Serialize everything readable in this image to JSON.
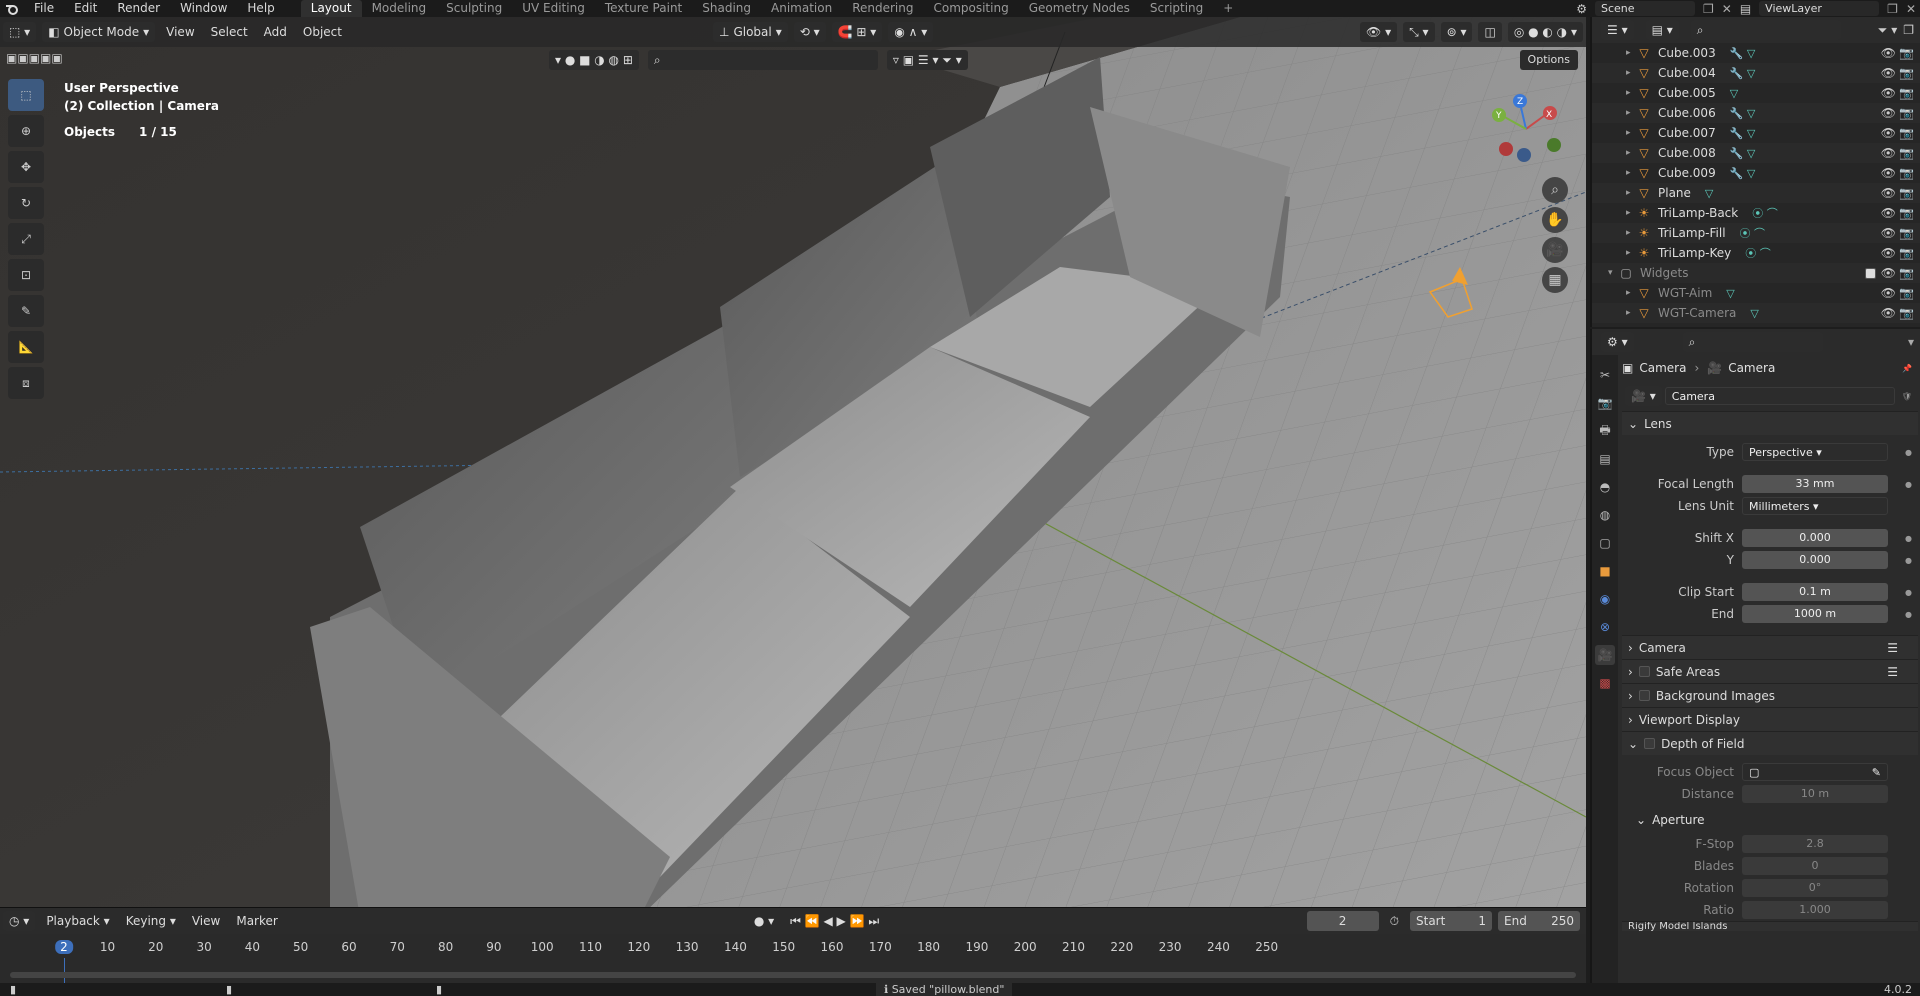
{
  "topbar": {
    "menu": [
      "File",
      "Edit",
      "Render",
      "Window",
      "Help"
    ],
    "workspaces": [
      "Layout",
      "Modeling",
      "Sculpting",
      "UV Editing",
      "Texture Paint",
      "Shading",
      "Animation",
      "Rendering",
      "Compositing",
      "Geometry Nodes",
      "Scripting"
    ],
    "active_workspace": "Layout",
    "add_tab": "+",
    "scene": "Scene",
    "viewlayer": "ViewLayer"
  },
  "viewport": {
    "mode": "Object Mode",
    "menus": [
      "View",
      "Select",
      "Add",
      "Object"
    ],
    "transform_orientation": "Global",
    "overlay_title": "User Perspective",
    "overlay_collection": "(2) Collection | Camera",
    "objects_label": "Objects",
    "objects_count": "1 / 15",
    "options": "Options",
    "gizmo_labels": {
      "x": "X",
      "y": "Y",
      "z": "Z"
    }
  },
  "timeline": {
    "menus": [
      "Playback",
      "Keying",
      "View",
      "Marker"
    ],
    "current_frame": "2",
    "start_label": "Start",
    "start": "1",
    "end_label": "End",
    "end": "250",
    "ruler": [
      "10",
      "20",
      "30",
      "40",
      "50",
      "60",
      "70",
      "80",
      "90",
      "100",
      "110",
      "120",
      "130",
      "140",
      "150",
      "160",
      "170",
      "180",
      "190",
      "200",
      "210",
      "220",
      "230",
      "240",
      "250"
    ]
  },
  "status": {
    "message": "Saved \"pillow.blend\"",
    "version": "4.0.2"
  },
  "outliner": {
    "rows": [
      {
        "name": "Cube.003",
        "type": "mesh",
        "mods": "🔧 ▽"
      },
      {
        "name": "Cube.004",
        "type": "mesh",
        "mods": "🔧 ▽"
      },
      {
        "name": "Cube.005",
        "type": "mesh",
        "mods": "▽"
      },
      {
        "name": "Cube.006",
        "type": "mesh",
        "mods": "🔧 ▽"
      },
      {
        "name": "Cube.007",
        "type": "mesh",
        "mods": "🔧 ▽"
      },
      {
        "name": "Cube.008",
        "type": "mesh",
        "mods": "🔧 ▽"
      },
      {
        "name": "Cube.009",
        "type": "mesh",
        "mods": "🔧 ▽"
      },
      {
        "name": "Plane",
        "type": "mesh",
        "mods": "▽"
      },
      {
        "name": "TriLamp-Back",
        "type": "light",
        "mods": "⦿ ⌒"
      },
      {
        "name": "TriLamp-Fill",
        "type": "light",
        "mods": "⦿ ⌒"
      },
      {
        "name": "TriLamp-Key",
        "type": "light",
        "mods": "⦿ ⌒"
      },
      {
        "name": "Widgets",
        "type": "collection",
        "mods": ""
      },
      {
        "name": "WGT-Aim",
        "type": "mesh",
        "mods": "▽"
      },
      {
        "name": "WGT-Camera",
        "type": "mesh",
        "mods": "▽"
      }
    ]
  },
  "properties": {
    "breadcrumb_obj": "Camera",
    "breadcrumb_data": "Camera",
    "datablock": "Camera",
    "lens_panel": "Lens",
    "type_label": "Type",
    "type_value": "Perspective",
    "focal_label": "Focal Length",
    "focal_value": "33 mm",
    "lens_unit_label": "Lens Unit",
    "lens_unit_value": "Millimeters",
    "shiftx_label": "Shift X",
    "shiftx_value": "0.000",
    "shifty_label": "Y",
    "shifty_value": "0.000",
    "clipstart_label": "Clip Start",
    "clipstart_value": "0.1 m",
    "clipend_label": "End",
    "clipend_value": "1000 m",
    "panels": [
      "Camera",
      "Safe Areas",
      "Background Images",
      "Viewport Display",
      "Depth of Field"
    ],
    "focus_object_label": "Focus Object",
    "distance_label": "Distance",
    "distance_value": "10 m",
    "aperture_panel": "Aperture",
    "fstop_label": "F-Stop",
    "fstop_value": "2.8",
    "blades_label": "Blades",
    "blades_value": "0",
    "rotation_label": "Rotation",
    "rotation_value": "0°",
    "ratio_label": "Ratio",
    "ratio_value": "1.000",
    "cut_panel": "Rigify Model Islands"
  }
}
